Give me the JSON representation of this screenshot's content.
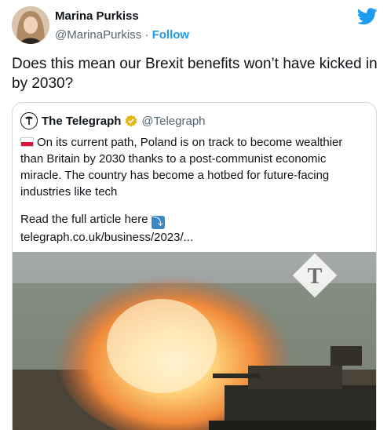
{
  "author": {
    "name": "Marina Purkiss",
    "handle": "@MarinaPurkiss",
    "separator": "·",
    "follow_label": "Follow"
  },
  "tweet": {
    "text": "Does this mean our Brexit benefits won’t have kicked in by 2030?"
  },
  "quoted": {
    "name": "The Telegraph",
    "handle": "@Telegraph",
    "verified": true,
    "flag": "poland-flag",
    "body": "On its current path, Poland is on track to become wealthier than Britain by 2030 thanks to a post-communist economic miracle. The country has become a hotbed for future-facing industries like tech",
    "read_more": "Read the full article here",
    "read_more_icon": "arrow-right-curving-down",
    "link": "telegraph.co.uk/business/2023/..."
  },
  "colors": {
    "accent": "#1d9bf0",
    "text": "#0f1419",
    "muted": "#536471",
    "border": "#cfd9de",
    "verified_gold": "#e2b719"
  },
  "icons": {
    "brand": "twitter-bird-icon",
    "publisher": "telegraph-logo-icon",
    "image_watermark": "telegraph-t-watermark-icon"
  }
}
